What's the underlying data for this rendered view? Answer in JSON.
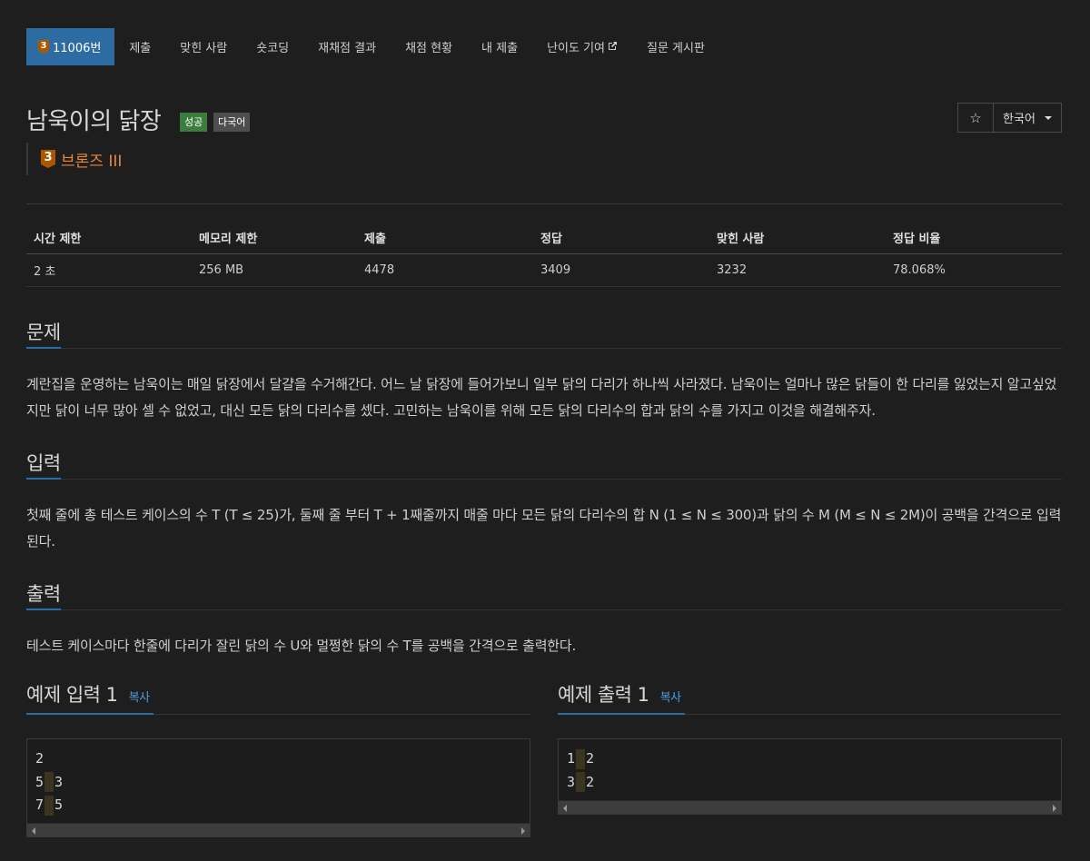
{
  "tabs": [
    {
      "label": "11006번",
      "tier": "3",
      "active": true
    },
    {
      "label": "제출"
    },
    {
      "label": "맞힌 사람"
    },
    {
      "label": "숏코딩"
    },
    {
      "label": "재채점 결과"
    },
    {
      "label": "채점 현황"
    },
    {
      "label": "내 제출"
    },
    {
      "label": "난이도 기여"
    },
    {
      "label": "질문 게시판"
    }
  ],
  "problem": {
    "title": "남욱이의 닭장",
    "label_success": "성공",
    "label_multilang": "다국어",
    "tier_number": "3",
    "tier_name": "브론즈 III",
    "star_icon": "☆",
    "language": "한국어"
  },
  "stats": {
    "headers": [
      "시간 제한",
      "메모리 제한",
      "제출",
      "정답",
      "맞힌 사람",
      "정답 비율"
    ],
    "values": [
      "2 초",
      "256 MB",
      "4478",
      "3409",
      "3232",
      "78.068%"
    ]
  },
  "sections": {
    "description_title": "문제",
    "description": "계란집을 운영하는 남욱이는 매일 닭장에서 달걀을 수거해간다. 어느 날 닭장에 들어가보니 일부 닭의 다리가 하나씩 사라졌다. 남욱이는 얼마나 많은 닭들이 한 다리를 잃었는지 알고싶었지만 닭이 너무 많아 셀 수 없었고, 대신 모든 닭의 다리수를 셌다. 고민하는 남욱이를 위해 모든 닭의 다리수의 합과 닭의 수를 가지고 이것을 해결해주자.",
    "input_title": "입력",
    "input": "첫째 줄에 총 테스트 케이스의 수 T (T ≤ 25)가, 둘째 줄 부터 T + 1째줄까지 매줄 마다 모든 닭의 다리수의 합 N (1 ≤ N ≤ 300)과 닭의 수 M (M ≤ N ≤ 2M)이 공백을 간격으로 입력된다.",
    "output_title": "출력",
    "output": "테스트 케이스마다 한줄에 다리가 잘린 닭의 수 U와 멀쩡한 닭의 수 T를 공백을 간격으로 출력한다."
  },
  "samples": {
    "input_title": "예제 입력 1",
    "output_title": "예제 출력 1",
    "copy_label": "복사",
    "input_lines": [
      [
        "2"
      ],
      [
        "5",
        "3"
      ],
      [
        "7",
        "5"
      ]
    ],
    "output_lines": [
      [
        "1",
        "2"
      ],
      [
        "3",
        "2"
      ]
    ]
  },
  "colors": {
    "accent": "#2d6ca2",
    "bronze": "#ad5600",
    "success": "#3c7c3c",
    "link": "#4a9fe0"
  }
}
